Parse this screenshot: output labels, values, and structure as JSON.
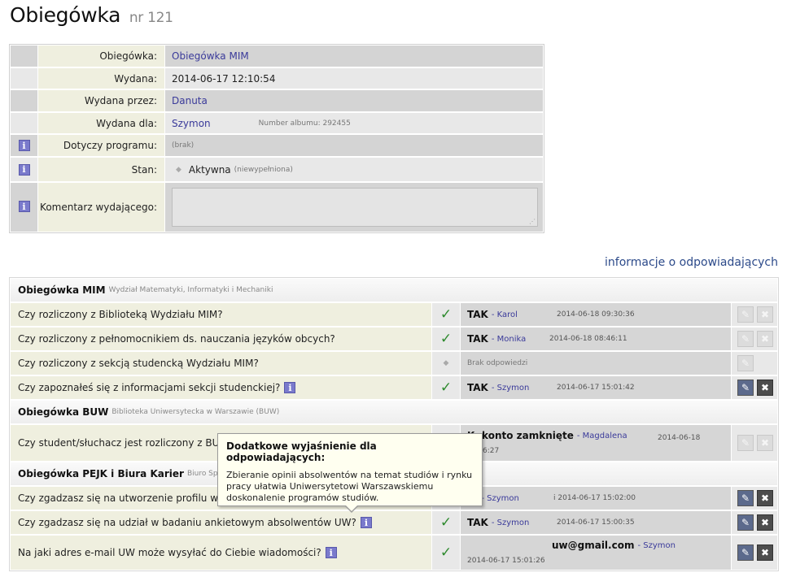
{
  "page": {
    "title": "Obiegówka",
    "nr": "nr 121"
  },
  "info": {
    "obiegowka_label": "Obiegówka:",
    "obiegowka_value": "Obiegówka MIM",
    "wydana_label": "Wydana:",
    "wydana_value": "2014-06-17 12:10:54",
    "wydana_przez_label": "Wydana przez:",
    "wydana_przez_value": "Danuta",
    "wydana_dla_label": "Wydana dla:",
    "wydana_dla_value": "Szymon",
    "album": "Number albumu: 292455",
    "program_label": "Dotyczy programu:",
    "program_value": "(brak)",
    "stan_label": "Stan:",
    "stan_value": "Aktywna",
    "stan_note": "(niewypełniona)",
    "komentarz_label": "Komentarz wydającego:"
  },
  "responders_link": "informacje o odpowiadających",
  "sections": {
    "mim": {
      "name": "Obiegówka MIM",
      "sub": "Wydział Matematyki, Informatyki i Mechaniki"
    },
    "buw": {
      "name": "Obiegówka BUW",
      "sub": "Biblioteka Uniwersytecka w Warszawie (BUW)"
    },
    "pejk": {
      "name": "Obiegówka PEJK i Biura Karier",
      "sub": "Biuro Spraw"
    }
  },
  "questions": {
    "q1": {
      "text": "Czy rozliczony z Biblioteką Wydziału MIM?",
      "answer": "TAK",
      "who": "- Karol",
      "date": "2014-06-18 09:30:36"
    },
    "q2": {
      "text": "Czy rozliczony z pełnomocnikiem ds. nauczania języków obcych?",
      "answer": "TAK",
      "who": "- Monika",
      "date": "2014-06-18 08:46:11"
    },
    "q3": {
      "text": "Czy rozliczony z sekcją studencką Wydziału MIM?",
      "answer": "Brak odpowiedzi"
    },
    "q4": {
      "text": "Czy zapoznałeś się z informacjami sekcji studenckiej?",
      "answer": "TAK",
      "who": "- Szymon",
      "date": "2014-06-17 15:01:42"
    },
    "q5": {
      "text": "Czy student/słuchacz jest rozliczony z BUW",
      "answer": "K, konto zamknięte",
      "who": "- Magdalena",
      "date": "2014-06-18",
      "date2": "6:27"
    },
    "q6": {
      "text": "Czy zgadzasz się na utworzenie profilu w se",
      "answer": "K",
      "who": "- Szymon",
      "date": "i 2014-06-17 15:02:00"
    },
    "q7": {
      "text": "Czy zgadzasz się na udział w badaniu ankietowym absolwentów UW?",
      "answer": "TAK",
      "who": "- Szymon",
      "date": "2014-06-17 15:00:35"
    },
    "q8": {
      "text": "Na jaki adres e-mail UW może wysyłać do Ciebie wiadomości?",
      "answer": "uw@gmail.com",
      "who": "- Szymon",
      "date": "2014-06-17 15:01:26"
    }
  },
  "tooltip": {
    "title": "Dodatkowe wyjaśnienie dla odpowiadających:",
    "body": "Zbieranie opinii absolwentów na temat studiów i rynku pracy ułatwia Uniwersytetowi Warszawskiemu doskonalenie programów studiów."
  },
  "icons": {
    "info": "i",
    "check": "✓",
    "edit": "✎",
    "delete": "✖",
    "dot": "◆"
  }
}
